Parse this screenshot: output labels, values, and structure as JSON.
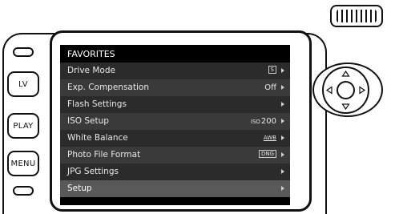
{
  "camera": {
    "buttons": [
      {
        "label": ""
      },
      {
        "label": "LV"
      },
      {
        "label": "PLAY"
      },
      {
        "label": "MENU"
      },
      {
        "label": ""
      }
    ]
  },
  "menu": {
    "title": "FAVORITES",
    "items": [
      {
        "label": "Drive Mode",
        "value": "S",
        "value_type": "badge"
      },
      {
        "label": "Exp. Compensation",
        "value": "Off",
        "value_type": "text"
      },
      {
        "label": "Flash Settings",
        "value": "",
        "value_type": "none"
      },
      {
        "label": "ISO Setup",
        "value_prefix": "ISO",
        "value": "200",
        "value_type": "iso"
      },
      {
        "label": "White Balance",
        "value": "AWB",
        "value_type": "underline"
      },
      {
        "label": "Photo File Format",
        "value": "DNG",
        "value_type": "badge"
      },
      {
        "label": "JPG Settings",
        "value": "",
        "value_type": "none"
      },
      {
        "label": "Setup",
        "value": "",
        "value_type": "none",
        "selected": true
      }
    ]
  },
  "colors": {
    "screen_bg": "#000000",
    "row_dark": "#2b2b2b",
    "row_light": "#3a3a3a",
    "row_selected": "#595959",
    "outline": "#111111"
  }
}
